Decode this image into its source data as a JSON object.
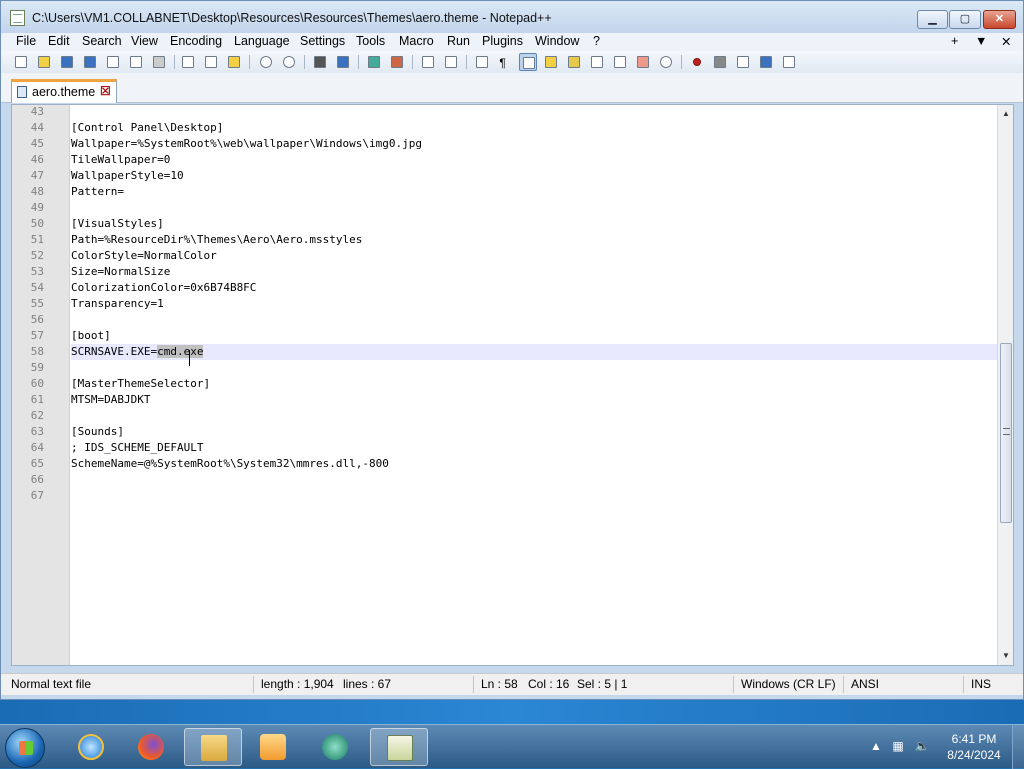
{
  "window": {
    "title": "C:\\Users\\VM1.COLLABNET\\Desktop\\Resources\\Resources\\Themes\\aero.theme - Notepad++",
    "min_label": "▁",
    "max_label": "▢",
    "close_label": "✕"
  },
  "menu": {
    "items": [
      "File",
      "Edit",
      "Search",
      "View",
      "Encoding",
      "Language",
      "Settings",
      "Tools",
      "Macro",
      "Run",
      "Plugins",
      "Window",
      "?"
    ],
    "right": [
      "+",
      "▼",
      "✕"
    ]
  },
  "tab": {
    "label": "aero.theme",
    "close": "☒"
  },
  "editor": {
    "lines": [
      {
        "n": "43",
        "text": ""
      },
      {
        "n": "44",
        "text": "[Control Panel\\Desktop]"
      },
      {
        "n": "45",
        "text": "Wallpaper=%SystemRoot%\\web\\wallpaper\\Windows\\img0.jpg"
      },
      {
        "n": "46",
        "text": "TileWallpaper=0"
      },
      {
        "n": "47",
        "text": "WallpaperStyle=10"
      },
      {
        "n": "48",
        "text": "Pattern="
      },
      {
        "n": "49",
        "text": ""
      },
      {
        "n": "50",
        "text": "[VisualStyles]"
      },
      {
        "n": "51",
        "text": "Path=%ResourceDir%\\Themes\\Aero\\Aero.msstyles"
      },
      {
        "n": "52",
        "text": "ColorStyle=NormalColor"
      },
      {
        "n": "53",
        "text": "Size=NormalSize"
      },
      {
        "n": "54",
        "text": "ColorizationColor=0x6B74B8FC"
      },
      {
        "n": "55",
        "text": "Transparency=1"
      },
      {
        "n": "56",
        "text": ""
      },
      {
        "n": "57",
        "text": "[boot]"
      },
      {
        "n": "58",
        "text": "SCRNSAVE.EXE=cmd.exe"
      },
      {
        "n": "59",
        "text": ""
      },
      {
        "n": "60",
        "text": "[MasterThemeSelector]"
      },
      {
        "n": "61",
        "text": "MTSM=DABJDKT"
      },
      {
        "n": "62",
        "text": ""
      },
      {
        "n": "63",
        "text": "[Sounds]"
      },
      {
        "n": "64",
        "text": "; IDS_SCHEME_DEFAULT"
      },
      {
        "n": "65",
        "text": "SchemeName=@%SystemRoot%\\System32\\mmres.dll,-800"
      },
      {
        "n": "66",
        "text": ""
      },
      {
        "n": "67",
        "text": ""
      }
    ],
    "current_line": {
      "prefix": "SCRNSAVE.EXE=",
      "selected": "cmd.exe"
    }
  },
  "status": {
    "file_type": "Normal text file",
    "length": "length : 1,904",
    "lines": "lines : 67",
    "ln": "Ln : 58",
    "col": "Col : 16",
    "sel": "Sel : 5 | 1",
    "eol": "Windows (CR LF)",
    "encoding": "ANSI",
    "mode": "INS"
  },
  "taskbar": {
    "time": "6:41 PM",
    "date": "8/24/2024",
    "apps": [
      "internet-explorer",
      "firefox",
      "file-explorer",
      "media-player",
      "chat-app",
      "notepad-plus-plus"
    ]
  }
}
